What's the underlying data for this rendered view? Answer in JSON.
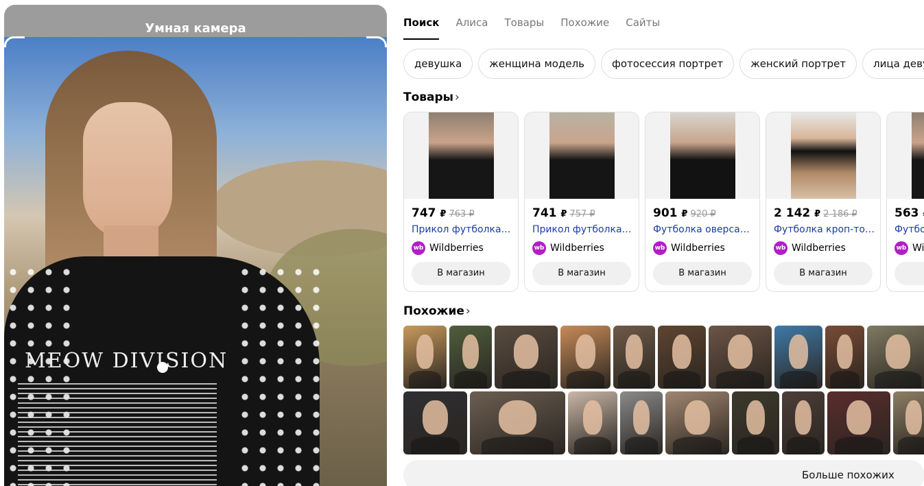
{
  "camera": {
    "title": "Умная камера",
    "shirt_text": "MEOW DIVISION"
  },
  "tabs": [
    {
      "label": "Поиск",
      "active": true
    },
    {
      "label": "Алиса"
    },
    {
      "label": "Товары"
    },
    {
      "label": "Похожие"
    },
    {
      "label": "Сайты"
    }
  ],
  "chips": [
    "девушка",
    "женщина модель",
    "фотосессия портрет",
    "женский портрет",
    "лица девушек"
  ],
  "products_section": {
    "title": "Товары",
    "chevron": "›"
  },
  "products": [
    {
      "price": "747",
      "currency": "₽",
      "old_price": "763 ₽",
      "name": "Прикол футболка с ...",
      "shop": "Wildberries",
      "button": "В магазин"
    },
    {
      "price": "741",
      "currency": "₽",
      "old_price": "757 ₽",
      "name": "Прикол футболка с ...",
      "shop": "Wildberries",
      "button": "В магазин"
    },
    {
      "price": "901",
      "currency": "₽",
      "old_price": "920 ₽",
      "name": "Футболка оверсайз ...",
      "shop": "Wildberries",
      "button": "В магазин"
    },
    {
      "price": "2 142",
      "currency": "₽",
      "old_price": "2 186 ₽",
      "name": "Футболка кроп-топ ...",
      "shop": "Wildberries",
      "button": "В магазин"
    },
    {
      "price": "563",
      "currency": "₽",
      "old_price": "",
      "name": "Футбо",
      "shop": "Wi",
      "button": "В"
    }
  ],
  "shop_icon_text": "wb",
  "similar_section": {
    "title": "Похожие",
    "chevron": "›"
  },
  "similar_row1_colors": [
    "#c89a5c",
    "#4f5e3c",
    "#5a4c40",
    "#c78b58",
    "#6e5a48",
    "#5f4530",
    "#6b5546",
    "#3f7aa8",
    "#7a4b36",
    "#7f7a62"
  ],
  "similar_row2_colors": [
    "#2f2f33",
    "#6c5e52",
    "#c9b7a7",
    "#8a8a8a",
    "#a08670",
    "#3c3a2c",
    "#4d3d38",
    "#5a2d2d",
    "#8d7f65"
  ],
  "more_button": "Больше похожих"
}
